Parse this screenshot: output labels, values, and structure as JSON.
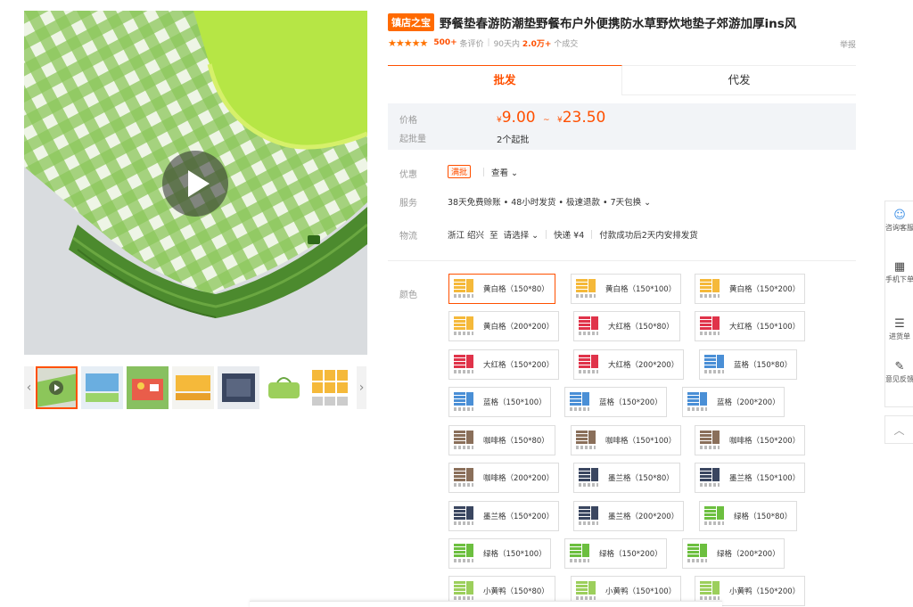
{
  "title": {
    "badge": "镇店之宝",
    "text": "野餐垫春游防潮垫野餐布户外便携防水草野炊地垫子郊游加厚ins风"
  },
  "meta": {
    "stars": "★★★★★",
    "reviews_count": "500+",
    "reviews_label": "条评价",
    "period": "90天内",
    "sales_count": "2.0万+",
    "sales_label": "个成交",
    "report": "举报"
  },
  "tabs": [
    {
      "label": "批发",
      "active": true
    },
    {
      "label": "代发",
      "active": false
    }
  ],
  "price": {
    "label": "价格",
    "currency": "¥",
    "min": "9.00",
    "tilde": "~",
    "max": "23.50",
    "moq_label": "起批量",
    "moq_value": "2个起批"
  },
  "discount": {
    "label": "优惠",
    "tag": "满批",
    "link": "查看 ⌄"
  },
  "service": {
    "label": "服务",
    "text": "38天免费赊账 • 48小时发货 • 极速退款 • 7天包换 ⌄"
  },
  "logistics": {
    "label": "物流",
    "from": "浙江 绍兴",
    "to": "至",
    "select": "请选择 ⌄",
    "express": "快递 ¥4",
    "note": "付款成功后2天内安排发货"
  },
  "sku": {
    "label": "颜色",
    "items": [
      {
        "label": "黄白格（150*80）",
        "color": "#f5b93a"
      },
      {
        "label": "黄白格（150*100）",
        "color": "#f5b93a"
      },
      {
        "label": "黄白格（150*200）",
        "color": "#f5b93a"
      },
      {
        "label": "黄白格（200*200）",
        "color": "#f5b93a"
      },
      {
        "label": "大红格（150*80）",
        "color": "#e0334a"
      },
      {
        "label": "大红格（150*100）",
        "color": "#e0334a"
      },
      {
        "label": "大红格（150*200）",
        "color": "#e0334a"
      },
      {
        "label": "大红格（200*200）",
        "color": "#e0334a"
      },
      {
        "label": "蓝格（150*80）",
        "color": "#4a8fd6"
      },
      {
        "label": "蓝格（150*100）",
        "color": "#4a8fd6"
      },
      {
        "label": "蓝格（150*200）",
        "color": "#4a8fd6"
      },
      {
        "label": "蓝格（200*200）",
        "color": "#4a8fd6"
      },
      {
        "label": "咖啡格（150*80）",
        "color": "#8a6f5a"
      },
      {
        "label": "咖啡格（150*100）",
        "color": "#8a6f5a"
      },
      {
        "label": "咖啡格（150*200）",
        "color": "#8a6f5a"
      },
      {
        "label": "咖啡格（200*200）",
        "color": "#8a6f5a"
      },
      {
        "label": "墨兰格（150*80）",
        "color": "#3a4660"
      },
      {
        "label": "墨兰格（150*100）",
        "color": "#3a4660"
      },
      {
        "label": "墨兰格（150*200）",
        "color": "#3a4660"
      },
      {
        "label": "墨兰格（200*200）",
        "color": "#3a4660"
      },
      {
        "label": "绿格（150*80）",
        "color": "#6cbf3f"
      },
      {
        "label": "绿格（150*100）",
        "color": "#6cbf3f"
      },
      {
        "label": "绿格（150*200）",
        "color": "#6cbf3f"
      },
      {
        "label": "绿格（200*200）",
        "color": "#6cbf3f"
      },
      {
        "label": "小黄鸭（150*80）",
        "color": "#9ccf5c"
      },
      {
        "label": "小黄鸭（150*100）",
        "color": "#9ccf5c"
      },
      {
        "label": "小黄鸭（150*200）",
        "color": "#9ccf5c"
      }
    ]
  },
  "side_bar": {
    "service": "咨询客服",
    "mobile": "手机下单",
    "cart": "进货单",
    "feedback": "意见反馈",
    "top": "︿"
  },
  "gallery": {
    "thumbs": [
      "video-thumb",
      "blue-mat",
      "picnic-scene",
      "yellow-mat",
      "navy-mat",
      "green-bag",
      "color-chart"
    ],
    "arrow_left": "‹",
    "arrow_right": "›"
  },
  "colors": {
    "accent": "#ff5000",
    "mat_green": "#7dba4a",
    "mat_yellow": "#b6e645"
  }
}
